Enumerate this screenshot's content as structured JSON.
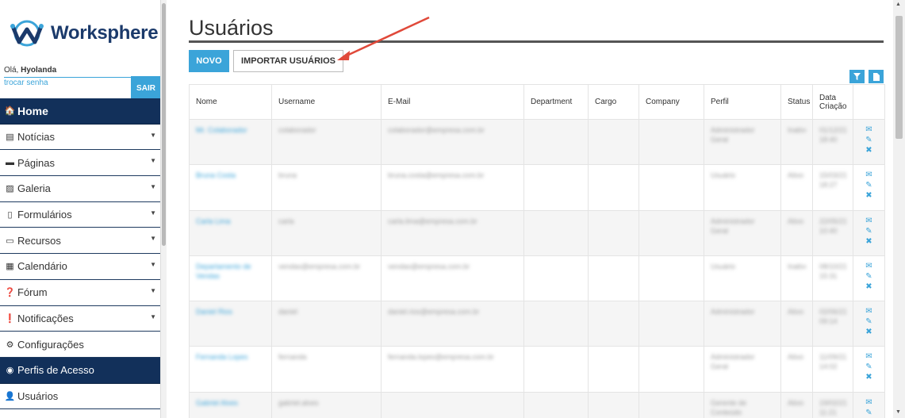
{
  "brand": {
    "name": "Worksphere",
    "logo_color": "#1b3a6b",
    "accent": "#3ba4d9"
  },
  "user": {
    "greeting": "Olá,",
    "name": "Hyolanda",
    "change_password": "trocar senha",
    "logout": "SAIR"
  },
  "menu": [
    {
      "icon": "home-icon",
      "label": "Home",
      "dark": true,
      "caret": false
    },
    {
      "icon": "newspaper-icon",
      "label": "Notícias",
      "dark": false,
      "caret": true
    },
    {
      "icon": "window-icon",
      "label": "Páginas",
      "dark": false,
      "caret": true
    },
    {
      "icon": "image-icon",
      "label": "Galeria",
      "dark": false,
      "caret": true
    },
    {
      "icon": "file-icon",
      "label": "Formulários",
      "dark": false,
      "caret": true
    },
    {
      "icon": "laptop-icon",
      "label": "Recursos",
      "dark": false,
      "caret": true
    },
    {
      "icon": "calendar-icon",
      "label": "Calendário",
      "dark": false,
      "caret": true
    },
    {
      "icon": "question-icon",
      "label": "Fórum",
      "dark": false,
      "caret": true
    },
    {
      "icon": "exclamation-icon",
      "label": "Notificações",
      "dark": false,
      "caret": true
    },
    {
      "icon": "gear-icon",
      "label": "Configurações",
      "dark": false,
      "caret": false
    },
    {
      "icon": "user-circle-icon",
      "label": "Perfis de Acesso",
      "dark": true,
      "caret": false
    },
    {
      "icon": "user-icon",
      "label": "Usuários",
      "dark": false,
      "caret": false
    }
  ],
  "page": {
    "title": "Usuários",
    "new_button": "NOVO",
    "import_button": "IMPORTAR USUÁRIOS"
  },
  "toolbar": {
    "filter_icon": "filter-icon",
    "export_icon": "document-icon"
  },
  "table": {
    "columns": [
      "Nome",
      "Username",
      "E-Mail",
      "Department",
      "Cargo",
      "Company",
      "Perfil",
      "Status",
      "Data Criação",
      ""
    ],
    "rows": [
      {
        "nome": "Mr. Colaborador",
        "username": "colaborador",
        "email": "colaborador@empresa.com.br",
        "perfil": "Administrador Geral",
        "status": "Inativo",
        "data": "01/12/21 18:40"
      },
      {
        "nome": "Bruna Costa",
        "username": "bruna",
        "email": "bruna.costa@empresa.com.br",
        "perfil": "Usuário",
        "status": "Ativo",
        "data": "15/03/21 18:27"
      },
      {
        "nome": "Carla Lima",
        "username": "carla",
        "email": "carla.lima@empresa.com.br",
        "perfil": "Administrador Geral",
        "status": "Ativo",
        "data": "22/05/21 10:40"
      },
      {
        "nome": "Departamento de Vendas",
        "username": "vendas@empresa.com.br",
        "email": "vendas@empresa.com.br",
        "perfil": "Usuário",
        "status": "Inativo",
        "data": "08/10/21 15:31"
      },
      {
        "nome": "Daniel Rios",
        "username": "daniel",
        "email": "daniel.rios@empresa.com.br",
        "perfil": "Administrador",
        "status": "Ativo",
        "data": "02/06/21 09:14"
      },
      {
        "nome": "Fernanda Lopes",
        "username": "fernanda",
        "email": "fernanda.lopes@empresa.com.br",
        "perfil": "Administrador Geral",
        "status": "Ativo",
        "data": "11/09/21 14:02"
      },
      {
        "nome": "Gabriel Alves",
        "username": "gabriel.alves",
        "email": "",
        "perfil": "Gerente de Conteúdo",
        "status": "Ativo",
        "data": "19/02/21 11:21"
      }
    ]
  }
}
